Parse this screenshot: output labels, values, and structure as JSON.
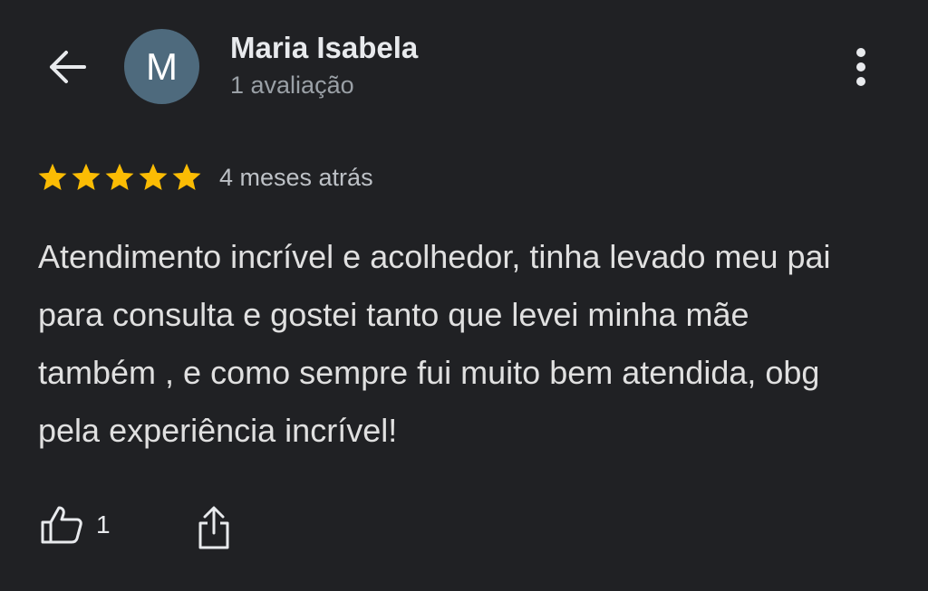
{
  "header": {
    "back_icon": "arrow-left-icon",
    "avatar_letter": "M",
    "avatar_color": "#4e6a7d",
    "reviewer_name": "Maria Isabela",
    "review_count_label": "1 avaliação",
    "more_icon": "more-vert-icon"
  },
  "review": {
    "rating": 5,
    "max_rating": 5,
    "star_color": "#fbbc04",
    "time_ago": "4 meses atrás",
    "text": "Atendimento incrível e acolhedor, tinha levado meu pai para consulta e gostei tanto que levei minha mãe também , e como sempre fui muito bem atendida, obg pela experiência incrível!"
  },
  "actions": {
    "like_icon": "thumb-up-icon",
    "like_count": "1",
    "share_icon": "share-icon"
  }
}
